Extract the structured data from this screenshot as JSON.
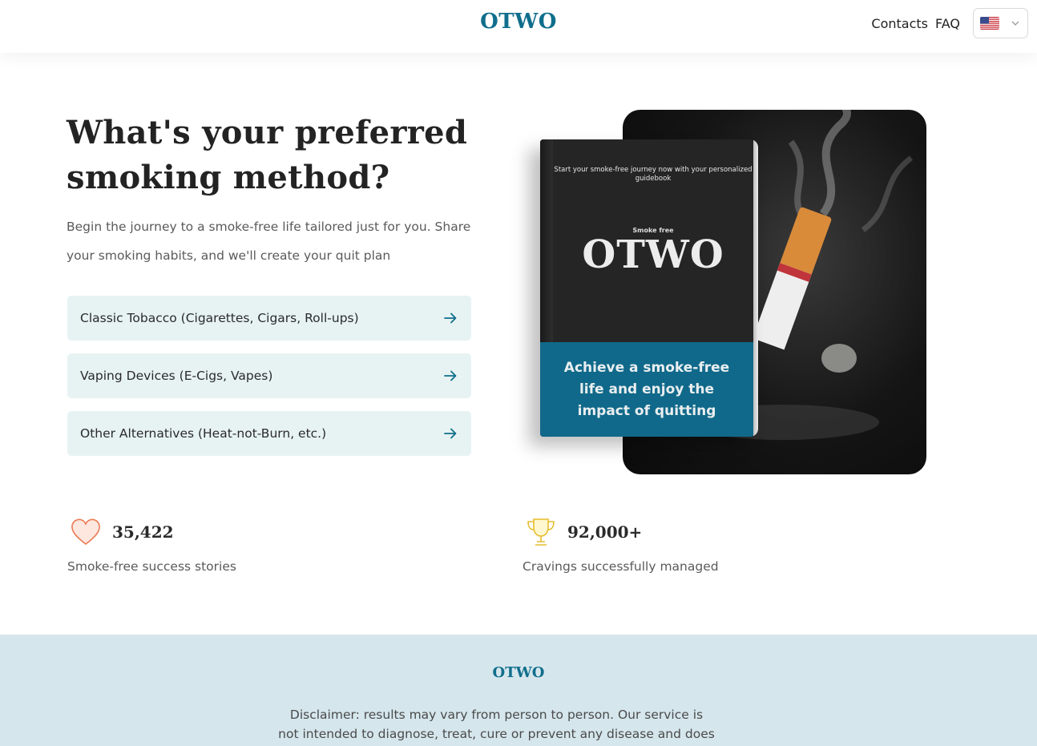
{
  "header": {
    "logo": "OTWO",
    "nav": [
      "Contacts",
      "FAQ"
    ],
    "language_flag_icon": "us-flag-icon"
  },
  "hero": {
    "title": "What's your preferred smoking method?",
    "lead": "Begin the journey to a smoke-free life tailored just for you. Share your smoking habits, and we'll create your quit plan",
    "options": [
      "Classic Tobacco (Cigarettes, Cigars, Roll-ups)",
      "Vaping Devices (E-Cigs, Vapes)",
      "Other Alternatives (Heat-not-Burn, etc.)"
    ],
    "book": {
      "tagline": "Start your smoke-free journey now with your personalized guidebook",
      "subtitle": "Smoke free",
      "logo": "OTWO",
      "band": "Achieve a smoke-free life and enjoy the impact of quitting"
    }
  },
  "stats": [
    {
      "icon": "heart-icon",
      "value": "35,422",
      "label": "Smoke-free success stories"
    },
    {
      "icon": "trophy-icon",
      "value": "92,000+",
      "label": "Cravings successfully managed"
    }
  ],
  "footer": {
    "logo": "OTWO",
    "disclaimer": "Disclaimer: results may vary from person to person. Our service is not intended to diagnose, treat, cure or prevent any disease and does not"
  },
  "colors": {
    "brand": "#106e8c",
    "option_bg": "#e7f3f3",
    "footer_bg": "#d5e6ec"
  }
}
